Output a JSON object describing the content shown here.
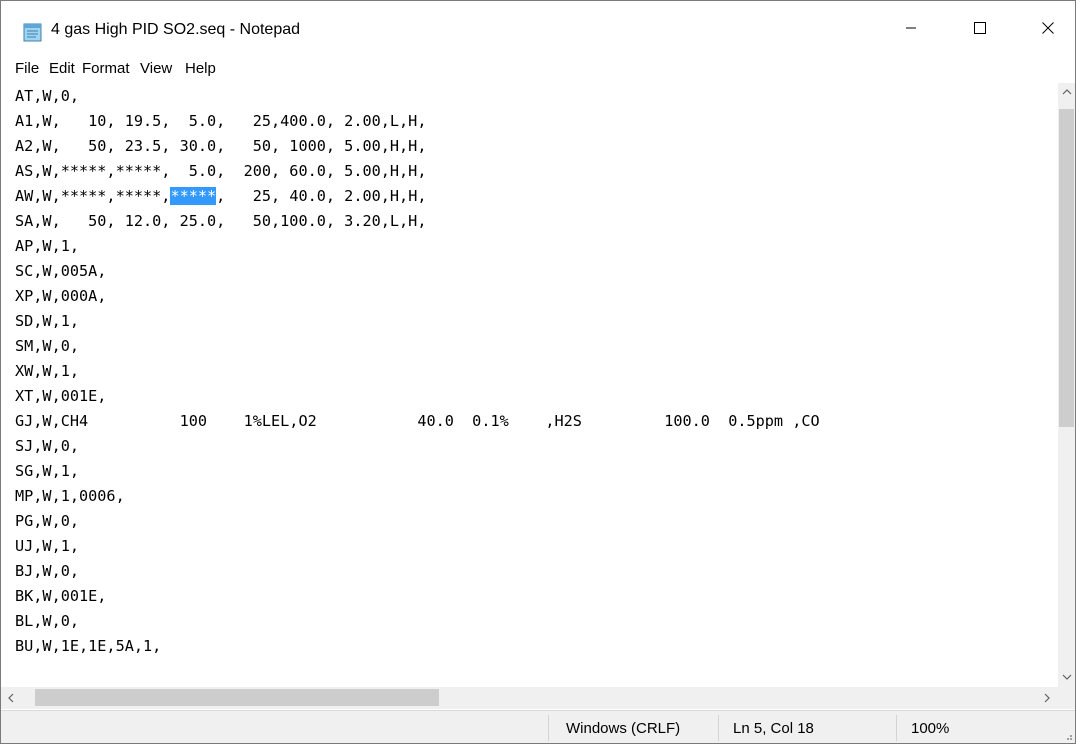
{
  "window": {
    "title": "4 gas High PID SO2.seq - Notepad",
    "icon": "notepad-icon"
  },
  "menu": [
    "File",
    "Edit",
    "Format",
    "View",
    "Help"
  ],
  "editor": {
    "lines": [
      {
        "text": "AT,W,0,"
      },
      {
        "text": "A1,W,   10, 19.5,  5.0,   25,400.0, 2.00,L,H,"
      },
      {
        "text": "A2,W,   50, 23.5, 30.0,   50, 1000, 5.00,H,H,"
      },
      {
        "text": "AS,W,*****,*****,  5.0,  200, 60.0, 5.00,H,H,"
      },
      {
        "pre": "AW,W,*****,*****,",
        "selected": "*****",
        "post": ",   25, 40.0, 2.00,H,H,"
      },
      {
        "text": "SA,W,   50, 12.0, 25.0,   50,100.0, 3.20,L,H,"
      },
      {
        "text": "AP,W,1,"
      },
      {
        "text": "SC,W,005A,"
      },
      {
        "text": "XP,W,000A,"
      },
      {
        "text": "SD,W,1,"
      },
      {
        "text": "SM,W,0,"
      },
      {
        "text": "XW,W,1,"
      },
      {
        "text": "XT,W,001E,"
      },
      {
        "text": "GJ,W,CH4          100    1%LEL,O2           40.0  0.1%    ,H2S         100.0  0.5ppm ,CO"
      },
      {
        "text": "SJ,W,0,"
      },
      {
        "text": "SG,W,1,"
      },
      {
        "text": "MP,W,1,0006,"
      },
      {
        "text": "PG,W,0,"
      },
      {
        "text": "UJ,W,1,"
      },
      {
        "text": "BJ,W,0,"
      },
      {
        "text": "BK,W,001E,"
      },
      {
        "text": "BL,W,0,"
      },
      {
        "text": "BU,W,1E,1E,5A,1,"
      }
    ]
  },
  "status": {
    "line_ending": "Windows (CRLF)",
    "position": "Ln 5, Col 18",
    "zoom": "100%"
  },
  "colors": {
    "selection": "#3399ff",
    "statusbar": "#f0f0f0",
    "scroll_thumb": "#cdcdcd"
  }
}
